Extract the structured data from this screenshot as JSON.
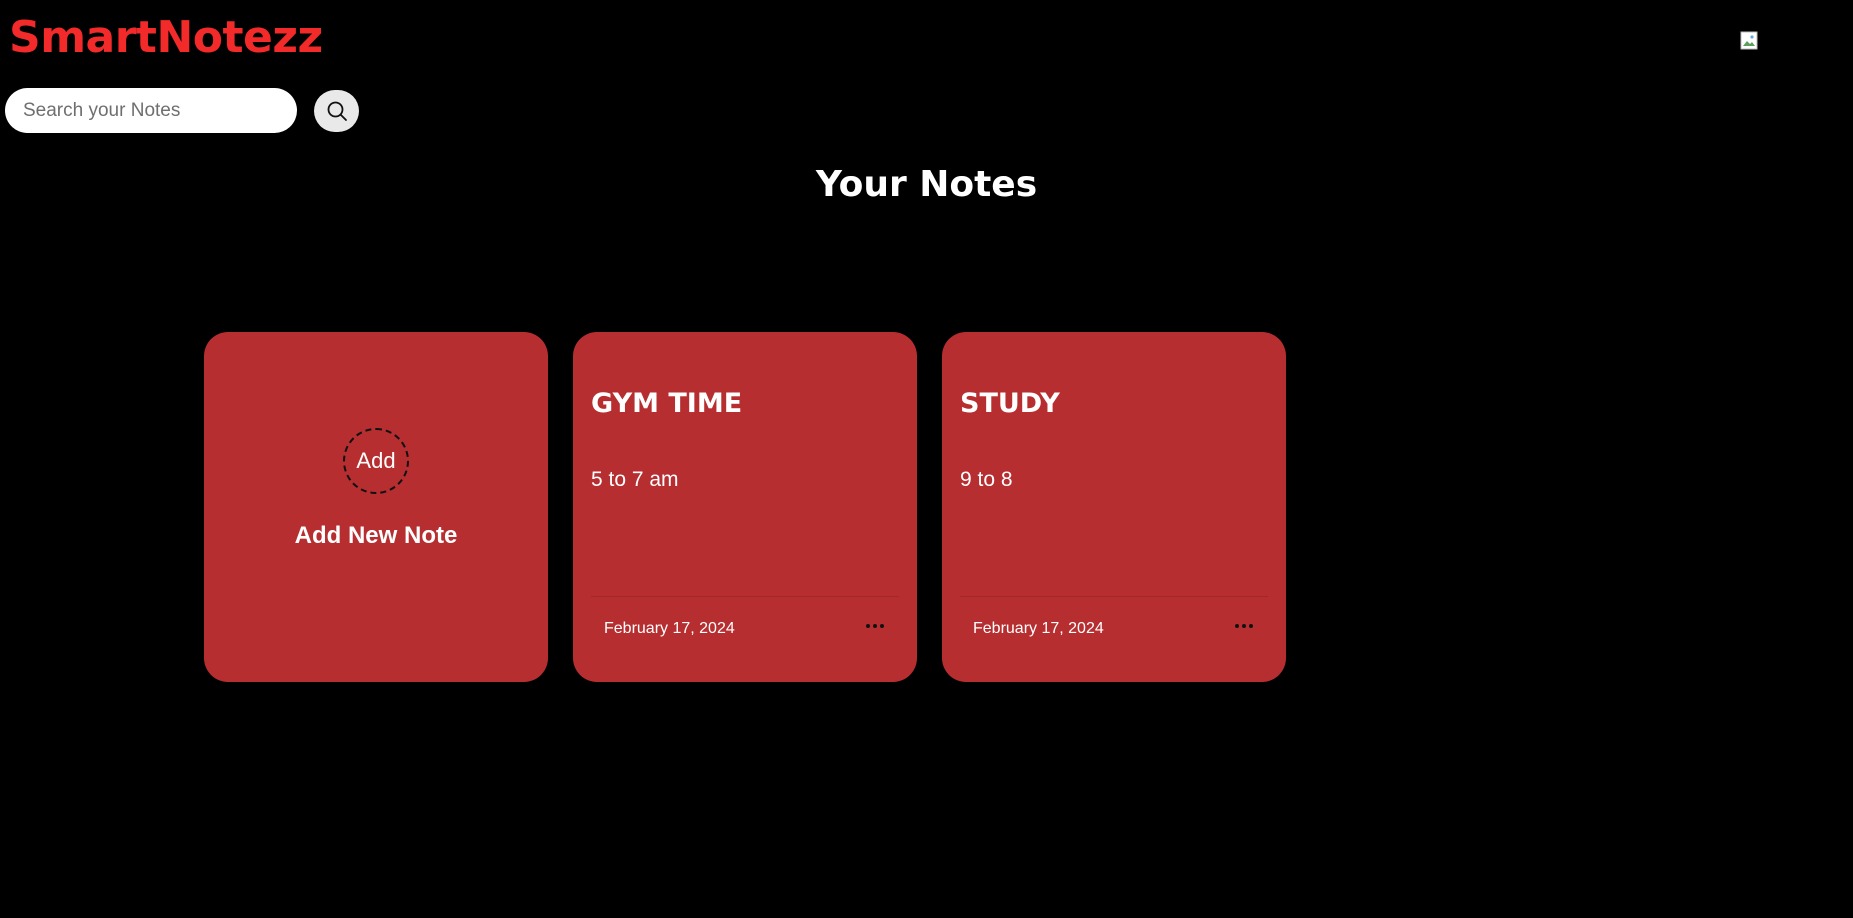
{
  "app": {
    "brand": "SmartNotezz",
    "profile_image_alt": ""
  },
  "search": {
    "placeholder": "Search your Notes",
    "value": "",
    "button_icon": "search-icon"
  },
  "main": {
    "title": "Your Notes",
    "add_card": {
      "icon_alt_text": "Add",
      "label": "Add New Note"
    },
    "notes": [
      {
        "title": "GYM TIME",
        "body": "5 to 7 am",
        "date": "February 17, 2024",
        "menu_icon": "more-options-icon"
      },
      {
        "title": "STUDY",
        "body": "9 to 8",
        "date": "February 17, 2024",
        "menu_icon": "more-options-icon"
      }
    ]
  },
  "colors": {
    "background": "#000000",
    "brand": "#f22a2a",
    "card": "#b72e31",
    "text": "#ffffff"
  }
}
